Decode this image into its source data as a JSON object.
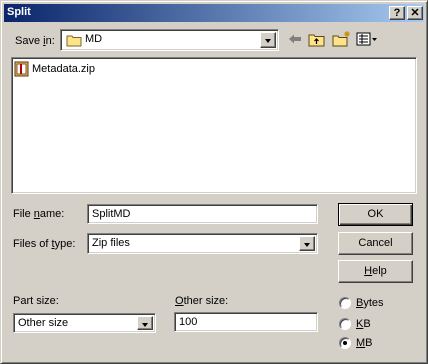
{
  "window": {
    "title": "Split"
  },
  "titlebar": {
    "help_glyph": "?",
    "close_glyph": "✕"
  },
  "save_in": {
    "label_pre": "Save ",
    "label_key": "i",
    "label_post": "n:",
    "value": "MD",
    "icon": "folder-icon"
  },
  "toolbar": {
    "back_icon": "back-arrow-icon",
    "up_icon": "up-folder-icon",
    "new_folder_icon": "new-folder-icon",
    "view_icon": "view-menu-icon"
  },
  "files": [
    {
      "name": "Metadata.zip",
      "icon": "zip-archive-icon"
    }
  ],
  "file_name": {
    "label_pre": "File ",
    "label_key": "n",
    "label_post": "ame:",
    "value": "SplitMD"
  },
  "file_type": {
    "label_pre": "Files of ",
    "label_key": "t",
    "label_post": "ype:",
    "value": "Zip files"
  },
  "buttons": {
    "ok": "OK",
    "cancel": "Cancel",
    "help_key": "H",
    "help_post": "elp"
  },
  "part_size": {
    "label_pre": "Part size",
    "label_key": "",
    "label_post": ":",
    "value": "Other size"
  },
  "other_size": {
    "label_key": "O",
    "label_post": "ther size:",
    "value": "100"
  },
  "units": [
    {
      "key": "B",
      "post": "ytes",
      "selected": false
    },
    {
      "key": "K",
      "post": "B",
      "selected": false
    },
    {
      "key": "M",
      "post": "B",
      "selected": true
    }
  ]
}
